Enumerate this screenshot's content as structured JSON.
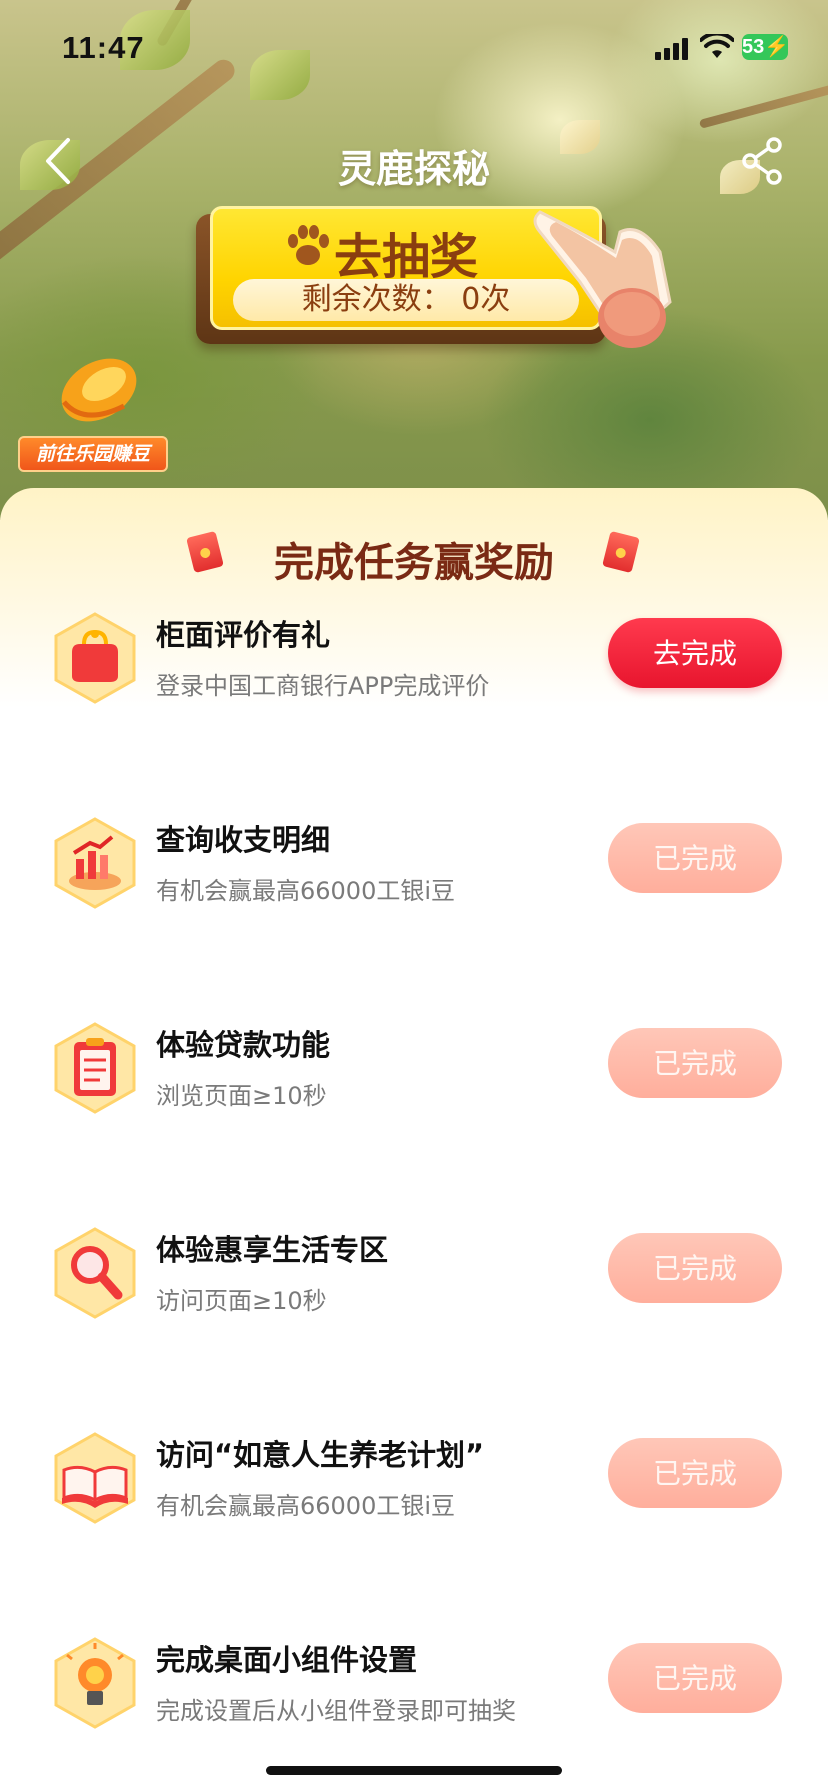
{
  "status_bar": {
    "time": "11:47",
    "battery": "53"
  },
  "nav": {
    "title": "灵鹿探秘"
  },
  "lottery": {
    "title": "去抽奖",
    "remaining": "剩余次数： 0次"
  },
  "park": {
    "label": "前往乐园赚豆"
  },
  "panel": {
    "title": "完成任务赢奖励"
  },
  "tasks": [
    {
      "title": "柜面评价有礼",
      "subtitle": "登录中国工商银行APP完成评价",
      "button": "去完成",
      "state": "active",
      "icon": "purse-icon"
    },
    {
      "title": "查询收支明细",
      "subtitle": "有机会赢最高66000工银i豆",
      "button": "已完成",
      "state": "done",
      "icon": "chart-icon"
    },
    {
      "title": "体验贷款功能",
      "subtitle": "浏览页面≥10秒",
      "button": "已完成",
      "state": "done",
      "icon": "clipboard-icon"
    },
    {
      "title": "体验惠享生活专区",
      "subtitle": "访问页面≥10秒",
      "button": "已完成",
      "state": "done",
      "icon": "magnifier-icon"
    },
    {
      "title": "访问“如意人生养老计划”",
      "subtitle": "有机会赢最高66000工银i豆",
      "button": "已完成",
      "state": "done",
      "icon": "book-icon"
    },
    {
      "title": "完成桌面小组件设置",
      "subtitle": "完成设置后从小组件登录即可抽奖",
      "button": "已完成",
      "state": "done",
      "icon": "lightbulb-icon"
    }
  ],
  "colors": {
    "accent": "#e8152e",
    "done": "#ffae9c",
    "panel_title": "#7a2a14"
  }
}
